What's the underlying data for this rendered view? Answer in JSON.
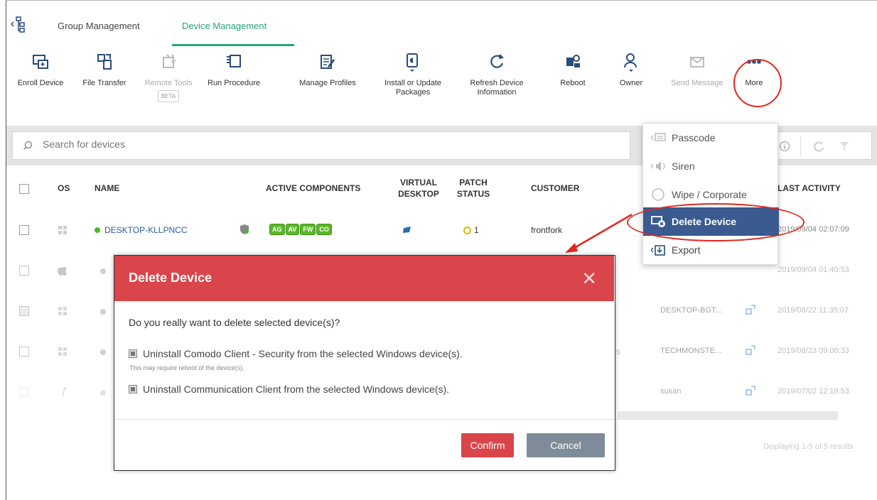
{
  "tabs": [
    {
      "label": "Group Management"
    },
    {
      "label": "Device Management"
    }
  ],
  "toolbar": {
    "enroll": "Enroll Device",
    "file_transfer": "File Transfer",
    "remote_tools": "Remote Tools",
    "beta": "BETA",
    "run_procedure": "Run Procedure",
    "manage_profiles": "Manage Profiles",
    "install_line1": "Install or Update",
    "install_line2": "Packages",
    "refresh_line1": "Refresh Device",
    "refresh_line2": "Information",
    "reboot": "Reboot",
    "owner": "Owner",
    "send_message": "Send Message",
    "more": "More"
  },
  "search": {
    "placeholder": "Search for devices"
  },
  "table": {
    "headers": {
      "os": "OS",
      "name": "NAME",
      "active_components": "ACTIVE COMPONENTS",
      "virtual_desktop_1": "VIRTUAL",
      "virtual_desktop_2": "DESKTOP",
      "patch_status_1": "PATCH",
      "patch_status_2": "STATUS",
      "customer": "CUSTOMER",
      "last_activity": "LAST ACTIVITY"
    },
    "rows": [
      {
        "name": "DESKTOP-KLLPNCC",
        "components": [
          "AG",
          "AV",
          "FW",
          "CO"
        ],
        "patch": "1",
        "customer": "frontfork",
        "last_activity": "2019/09/04 02:07:09"
      },
      {
        "last_activity": "2019/09/04 01:40:53"
      },
      {
        "owner": "DESKTOP-BGT...",
        "last_activity": "2019/08/22 11:35:07"
      },
      {
        "customer_tail": "s",
        "owner": "TECHMONSTE...",
        "last_activity": "2019/08/23 09:08:33"
      },
      {
        "owner": "susan",
        "last_activity": "2019/07/02 12:18:53"
      }
    ]
  },
  "menu": {
    "passcode": "Passcode",
    "siren": "Siren",
    "wipe": "Wipe / Corporate",
    "delete": "Delete Device",
    "export": "Export"
  },
  "dialog": {
    "title": "Delete Device",
    "question": "Do you really want to delete selected device(s)?",
    "option1": "Uninstall Comodo Client - Security from the selected Windows device(s).",
    "option1_note": "This may require reboot of the device(s).",
    "option2": "Uninstall Communication Client from the selected Windows device(s).",
    "confirm": "Confirm",
    "cancel": "Cancel"
  },
  "footer": {
    "displaying": "Displaying 1-5 of 5 results"
  },
  "colors": {
    "accent": "#2aa37a",
    "danger": "#d9454b",
    "menu_active": "#3a5a90",
    "annotation": "#e0271f"
  }
}
